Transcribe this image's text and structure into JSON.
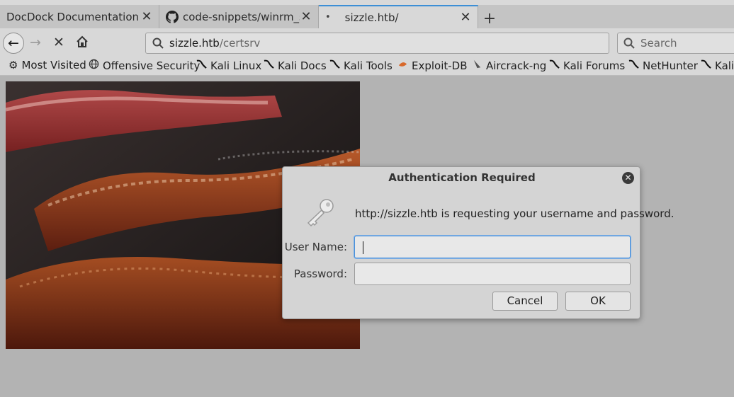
{
  "tabs": [
    {
      "label": "DocDock Documentation",
      "close": "✕",
      "active": false
    },
    {
      "label": "code-snippets/winrm_sh",
      "close": "✕",
      "active": false,
      "icon": "github-icon"
    },
    {
      "label": "sizzle.htb/",
      "close": "✕",
      "active": true,
      "icon": "dot-icon"
    }
  ],
  "new_tab_label": "+",
  "nav": {
    "url_host": "sizzle.htb",
    "url_path": "/certsrv",
    "search_placeholder": "Search"
  },
  "bookmarks": [
    {
      "label": "Most Visited",
      "icon": "gear-icon"
    },
    {
      "label": "Offensive Security",
      "icon": "globe-icon"
    },
    {
      "label": "Kali Linux",
      "icon": "kali-dragon-icon"
    },
    {
      "label": "Kali Docs",
      "icon": "kali-dragon-icon"
    },
    {
      "label": "Kali Tools",
      "icon": "kali-dragon-icon"
    },
    {
      "label": "Exploit-DB",
      "icon": "exploit-db-icon"
    },
    {
      "label": "Aircrack-ng",
      "icon": "aircrack-icon"
    },
    {
      "label": "Kali Forums",
      "icon": "kali-dragon-icon"
    },
    {
      "label": "NetHunter",
      "icon": "kali-dragon-icon"
    },
    {
      "label": "Kali",
      "icon": "kali-dragon-icon"
    }
  ],
  "content": {
    "image_subject": "bacon-frying-image"
  },
  "dialog": {
    "title": "Authentication Required",
    "close": "✕",
    "message": "http://sizzle.htb is requesting your username and password.",
    "username_label": "User Name:",
    "username_value": "",
    "password_label": "Password:",
    "password_value": "",
    "cancel_label": "Cancel",
    "ok_label": "OK"
  },
  "colors": {
    "accent_tab": "#3d8fd6",
    "focus_ring": "#4a90d9",
    "page_background": "#b3b3b3"
  }
}
